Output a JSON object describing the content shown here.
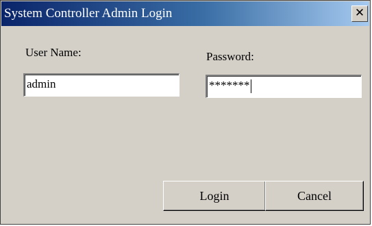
{
  "window": {
    "title": "System Controller Admin Login",
    "close_glyph": "✕"
  },
  "form": {
    "username_label": "User Name:",
    "username_value": "admin",
    "password_label": "Password:",
    "password_value": "*******"
  },
  "buttons": {
    "login_label": "Login",
    "cancel_label": "Cancel"
  },
  "icons": [
    "close-icon"
  ],
  "colors": {
    "titlebar_start": "#0a246a",
    "titlebar_end": "#a6caf0",
    "dialog_face": "#d4d0c8"
  }
}
